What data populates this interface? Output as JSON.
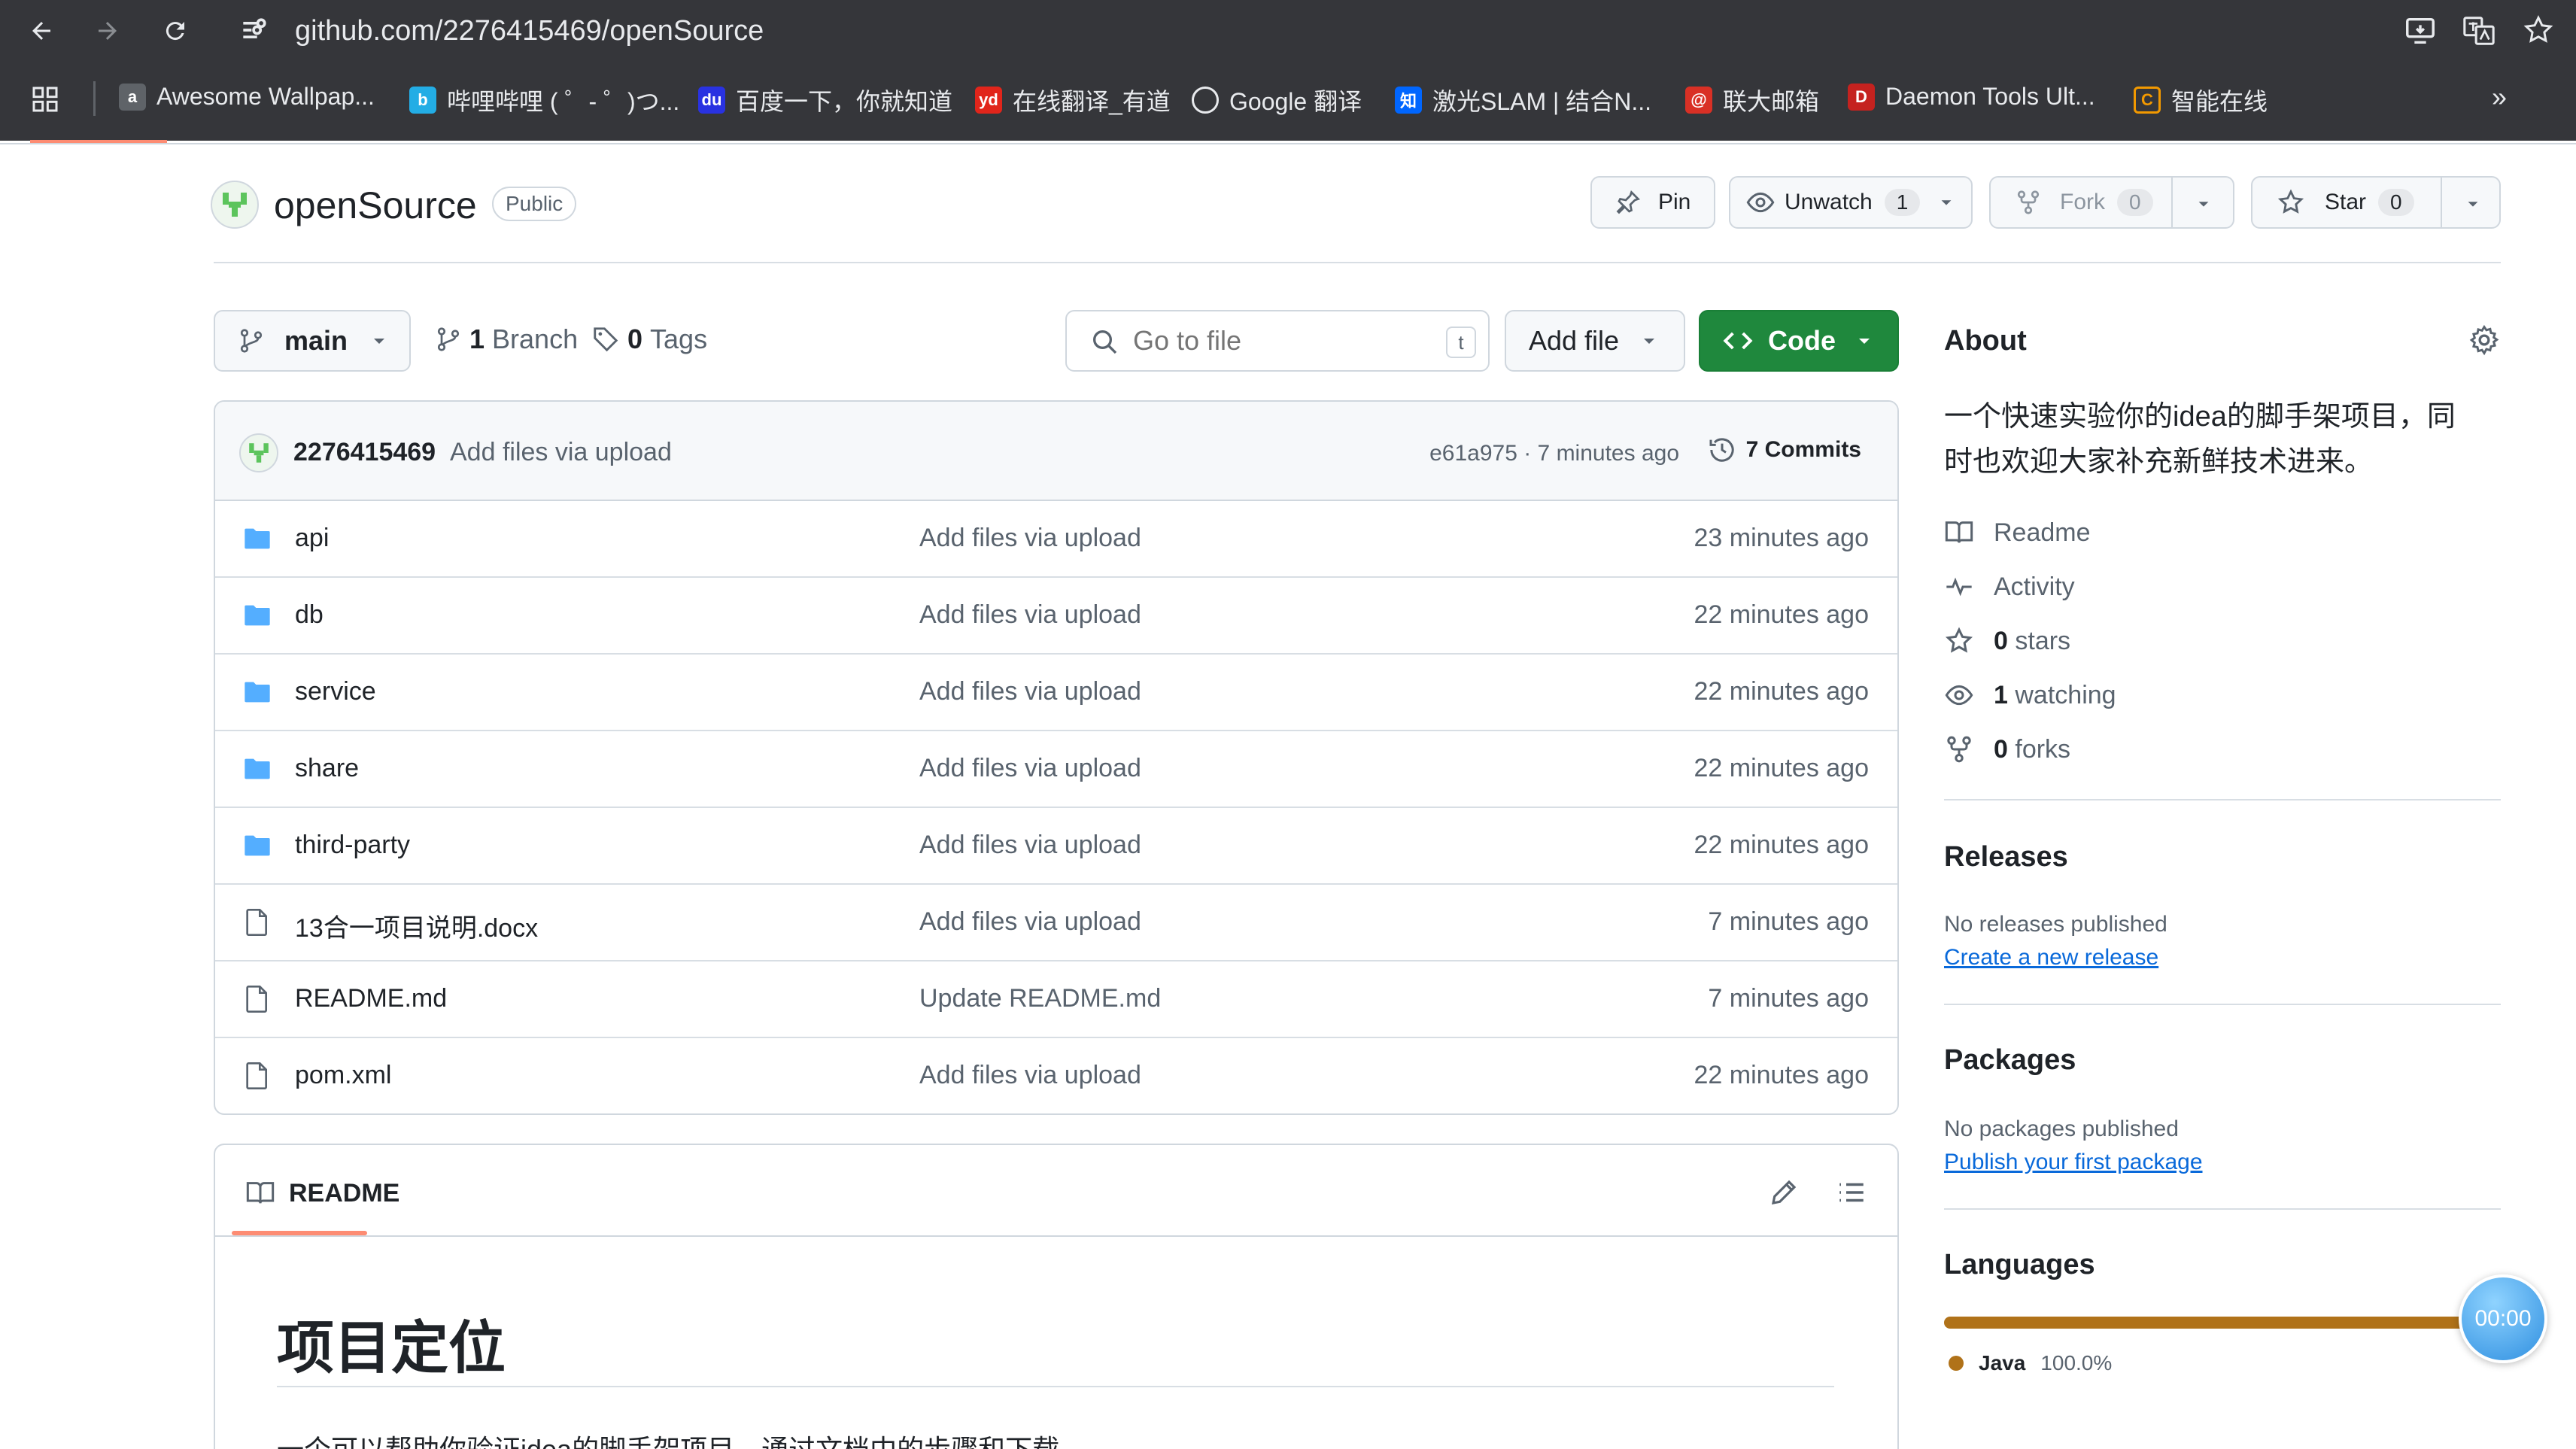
{
  "browser": {
    "url": "github.com/2276415469/openSource",
    "bookmarks": [
      {
        "label": "Awesome Wallpap...",
        "icon": "wallpaper-icon"
      },
      {
        "label": "哔哩哔哩 ( ゜- ゜)つ...",
        "icon": "bilibili-icon"
      },
      {
        "label": "百度一下，你就知道",
        "icon": "baidu-icon"
      },
      {
        "label": "在线翻译_有道",
        "icon": "youdao-icon"
      },
      {
        "label": "Google 翻译",
        "icon": "google-translate-icon"
      },
      {
        "label": "激光SLAM | 结合N...",
        "icon": "zhihu-icon"
      },
      {
        "label": "联大邮箱",
        "icon": "mail-icon"
      },
      {
        "label": "Daemon Tools Ult...",
        "icon": "daemon-tools-icon"
      },
      {
        "label": "智能在线",
        "icon": "smart-online-icon"
      }
    ]
  },
  "repo": {
    "name": "openSource",
    "visibility": "Public",
    "pin_label": "Pin",
    "unwatch_label": "Unwatch",
    "unwatch_count": "1",
    "fork_label": "Fork",
    "fork_count": "0",
    "star_label": "Star",
    "star_count": "0"
  },
  "toolbar": {
    "branch": "main",
    "branches_count": "1",
    "branches_label": "Branch",
    "tags_count": "0",
    "tags_label": "Tags",
    "search_placeholder": "Go to file",
    "search_shortcut": "t",
    "add_file_label": "Add file",
    "code_label": "Code"
  },
  "commit": {
    "author": "2276415469",
    "message": "Add files via upload",
    "hash_time": "e61a975 · 7 minutes ago",
    "commits_label": "7 Commits"
  },
  "files": [
    {
      "name": "api",
      "type": "folder",
      "message": "Add files via upload",
      "time": "23 minutes ago"
    },
    {
      "name": "db",
      "type": "folder",
      "message": "Add files via upload",
      "time": "22 minutes ago"
    },
    {
      "name": "service",
      "type": "folder",
      "message": "Add files via upload",
      "time": "22 minutes ago"
    },
    {
      "name": "share",
      "type": "folder",
      "message": "Add files via upload",
      "time": "22 minutes ago"
    },
    {
      "name": "third-party",
      "type": "folder",
      "message": "Add files via upload",
      "time": "22 minutes ago"
    },
    {
      "name": "13合一项目说明.docx",
      "type": "file",
      "message": "Add files via upload",
      "time": "7 minutes ago"
    },
    {
      "name": "README.md",
      "type": "file",
      "message": "Update README.md",
      "time": "7 minutes ago"
    },
    {
      "name": "pom.xml",
      "type": "file",
      "message": "Add files via upload",
      "time": "22 minutes ago"
    }
  ],
  "readme": {
    "tab_label": "README",
    "heading": "项目定位",
    "body_preview": "一个可以帮助你验证idea的脚手架项目，通过文档中的步骤和下载"
  },
  "about": {
    "title": "About",
    "description_line1": "一个快速实验你的idea的脚手架项目，同",
    "description_line2": "时也欢迎大家补充新鲜技术进来。",
    "readme_label": "Readme",
    "activity_label": "Activity",
    "stars_count": "0",
    "stars_label": "stars",
    "watching_count": "1",
    "watching_label": "watching",
    "forks_count": "0",
    "forks_label": "forks"
  },
  "releases": {
    "title": "Releases",
    "empty_text": "No releases published",
    "link": "Create a new release"
  },
  "packages": {
    "title": "Packages",
    "empty_text": "No packages published",
    "link": "Publish your first package"
  },
  "languages": {
    "title": "Languages",
    "items": [
      {
        "name": "Java",
        "percent": "100.0%",
        "color": "#b07219",
        "fraction": 1.0
      }
    ]
  },
  "overlay": {
    "timer": "00:00"
  },
  "colors": {
    "green_button": "#1f883d",
    "link_blue": "#0969da",
    "folder_blue": "#54aeff",
    "java": "#b07219"
  }
}
